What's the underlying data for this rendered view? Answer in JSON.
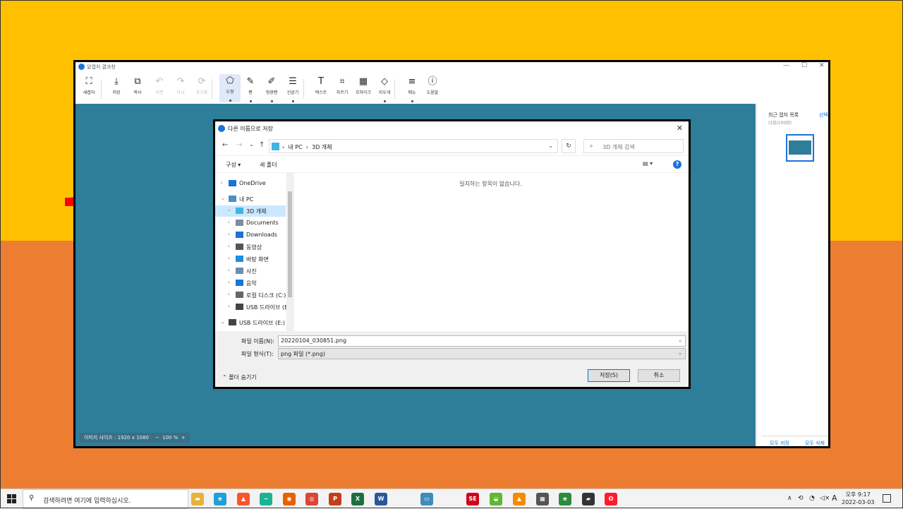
{
  "slide": {
    "colors": {
      "top": "#FFC000",
      "bottom": "#ED7D31",
      "arrow": "#FF0000"
    }
  },
  "app": {
    "title": "알캡처 결과창",
    "window_controls": [
      "—",
      "☐",
      "✕"
    ],
    "toolbar": [
      {
        "label": "새캡처",
        "icon": "crop-icon",
        "glyph": "⛶",
        "enabled": true
      },
      {
        "label": "저장",
        "icon": "download-icon",
        "glyph": "⤓",
        "enabled": true
      },
      {
        "label": "복사",
        "icon": "copy-icon",
        "glyph": "⧉",
        "enabled": true
      },
      {
        "label": "이전",
        "icon": "undo-icon",
        "glyph": "↶",
        "enabled": false
      },
      {
        "label": "다시",
        "icon": "redo-icon",
        "glyph": "↷",
        "enabled": false
      },
      {
        "label": "초기화",
        "icon": "reset-icon",
        "glyph": "⟳",
        "enabled": false
      },
      {
        "label": "도형",
        "icon": "shape-icon",
        "glyph": "⬠",
        "enabled": true,
        "active": true
      },
      {
        "label": "펜",
        "icon": "pen-icon",
        "glyph": "✎",
        "enabled": true
      },
      {
        "label": "형광펜",
        "icon": "highlighter-icon",
        "glyph": "✐",
        "enabled": true
      },
      {
        "label": "선굵기",
        "icon": "line-width-icon",
        "glyph": "☰",
        "enabled": true
      },
      {
        "label": "텍스트",
        "icon": "text-icon",
        "glyph": "T",
        "enabled": true
      },
      {
        "label": "자르기",
        "icon": "cut-icon",
        "glyph": "⌗",
        "enabled": true
      },
      {
        "label": "모자이크",
        "icon": "mosaic-icon",
        "glyph": "▦",
        "enabled": true
      },
      {
        "label": "지우개",
        "icon": "eraser-icon",
        "glyph": "◇",
        "enabled": true
      },
      {
        "label": "메뉴",
        "icon": "menu-icon",
        "glyph": "≡",
        "enabled": true
      },
      {
        "label": "도움말",
        "icon": "info-icon",
        "glyph": "ⓘ",
        "enabled": true
      }
    ],
    "status": {
      "image_size": "이미지 사이즈 : 1920 x 1080",
      "zoom_minus": "−",
      "zoom": "100 %",
      "zoom_plus": "+"
    },
    "side_panel": {
      "title": "최근 캡처 목록",
      "select": "선택",
      "count": "(1장/100장)",
      "save_all": "모두 저장",
      "delete_all": "모두 삭제"
    },
    "canvas_color": "#2E7D99"
  },
  "dialog": {
    "title": "다른 이름으로 저장",
    "close": "✕",
    "nav": {
      "back": "←",
      "forward": "→",
      "recent": "⌄",
      "up": "↑"
    },
    "address": {
      "path_1": "내 PC",
      "sep": "›",
      "path_2": "3D 개체",
      "dropdown": "⌄"
    },
    "refresh": "↻",
    "search_placeholder": "3D 개체 검색",
    "commands": {
      "organize": "구성 ▾",
      "new_folder": "새 폴더",
      "help": "?",
      "view": "▤ ▾"
    },
    "tree": [
      {
        "label": "OneDrive",
        "icon": "onedrive-icon",
        "level": 0,
        "chev": "›"
      },
      {
        "label": "내 PC",
        "icon": "pc-icon",
        "level": 0,
        "chev": "⌄"
      },
      {
        "label": "3D 개체",
        "icon": "3d-objects-icon",
        "level": 1,
        "chev": "›",
        "selected": true
      },
      {
        "label": "Documents",
        "icon": "documents-icon",
        "level": 1,
        "chev": "›"
      },
      {
        "label": "Downloads",
        "icon": "downloads-icon",
        "level": 1,
        "chev": "›"
      },
      {
        "label": "동영상",
        "icon": "videos-icon",
        "level": 1,
        "chev": "›"
      },
      {
        "label": "바탕 화면",
        "icon": "desktop-icon",
        "level": 1,
        "chev": "›"
      },
      {
        "label": "사진",
        "icon": "pictures-icon",
        "level": 1,
        "chev": "›"
      },
      {
        "label": "음악",
        "icon": "music-icon",
        "level": 1,
        "chev": "›"
      },
      {
        "label": "로컬 디스크 (C:)",
        "icon": "disk-icon",
        "level": 1,
        "chev": "›"
      },
      {
        "label": "USB 드라이브 (E",
        "icon": "usb-icon",
        "level": 1,
        "chev": "›"
      },
      {
        "label": "USB 드라이브 (E:)",
        "icon": "usb-icon",
        "level": 0,
        "chev": "⌄"
      }
    ],
    "empty_message": "일치하는 항목이 없습니다.",
    "filename_label": "파일 이름(N):",
    "filename_value": "20220104_030851.png",
    "filetype_label": "파일 형식(T):",
    "filetype_value": "png 파일 (*.png)",
    "hide_folders": "⌃ 폴더 숨기기",
    "save": "저장(S)",
    "cancel": "취소"
  },
  "taskbar": {
    "search_placeholder": "검색하려면 여기에 입력하십시오.",
    "apps": [
      {
        "name": "file-explorer-icon",
        "color": "#E8B23A",
        "glyph": "▬"
      },
      {
        "name": "edge-icon",
        "color": "#1FA0D8",
        "glyph": "e"
      },
      {
        "name": "brave-icon",
        "color": "#FB542B",
        "glyph": "▲"
      },
      {
        "name": "whale-icon",
        "color": "#1ab394",
        "glyph": "∽"
      },
      {
        "name": "firefox-icon",
        "color": "#E66000",
        "glyph": "◉"
      },
      {
        "name": "chrome-icon",
        "color": "#DB4437",
        "glyph": "◎"
      },
      {
        "name": "powerpoint-icon",
        "color": "#C43E1C",
        "glyph": "P"
      },
      {
        "name": "excel-icon",
        "color": "#1D6F42",
        "glyph": "X"
      },
      {
        "name": "word-icon",
        "color": "#2B579A",
        "glyph": "W"
      },
      {
        "name": "remote-desktop-icon",
        "color": "#3C8DBC",
        "glyph": "▭"
      },
      {
        "name": "screenshot-editor-icon",
        "color": "#D0021B",
        "glyph": "SE"
      },
      {
        "name": "android-icon",
        "color": "#5FB832",
        "glyph": "◒"
      },
      {
        "name": "vlc-icon",
        "color": "#F48B00",
        "glyph": "▲"
      },
      {
        "name": "calculator-icon",
        "color": "#555555",
        "glyph": "▦"
      },
      {
        "name": "edge-dev-icon",
        "color": "#2C8C3E",
        "glyph": "e"
      },
      {
        "name": "sticky-notes-icon",
        "color": "#333333",
        "glyph": "▰"
      },
      {
        "name": "opera-icon",
        "color": "#FF1B2D",
        "glyph": "O"
      }
    ],
    "tray": {
      "chevron": "∧",
      "net1": "⟲",
      "wifi": "◔",
      "volume": "◁×",
      "ime": "A"
    },
    "time_period": "오후 9:17",
    "date": "2022-03-03"
  }
}
